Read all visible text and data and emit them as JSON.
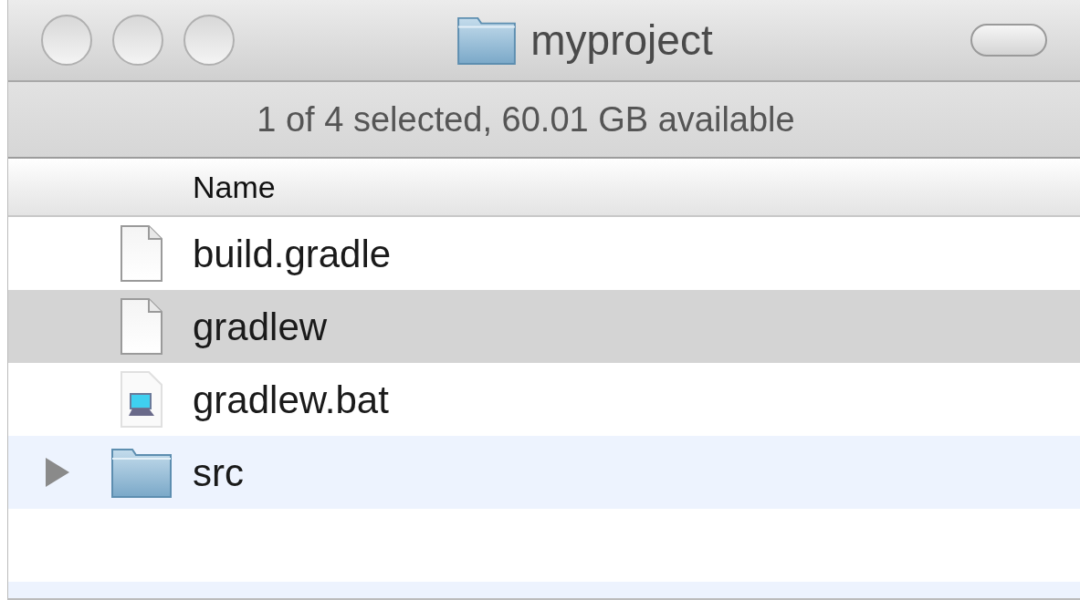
{
  "window": {
    "title": "myproject"
  },
  "status_bar": {
    "text": "1 of 4 selected, 60.01 GB available"
  },
  "table": {
    "columns": [
      "Name"
    ],
    "rows": [
      {
        "kind": "file",
        "name": "build.gradle",
        "selected": false
      },
      {
        "kind": "file",
        "name": "gradlew",
        "selected": true
      },
      {
        "kind": "app",
        "name": "gradlew.bat",
        "selected": false
      },
      {
        "kind": "folder",
        "name": "src",
        "selected": false,
        "expanded": false
      }
    ]
  }
}
